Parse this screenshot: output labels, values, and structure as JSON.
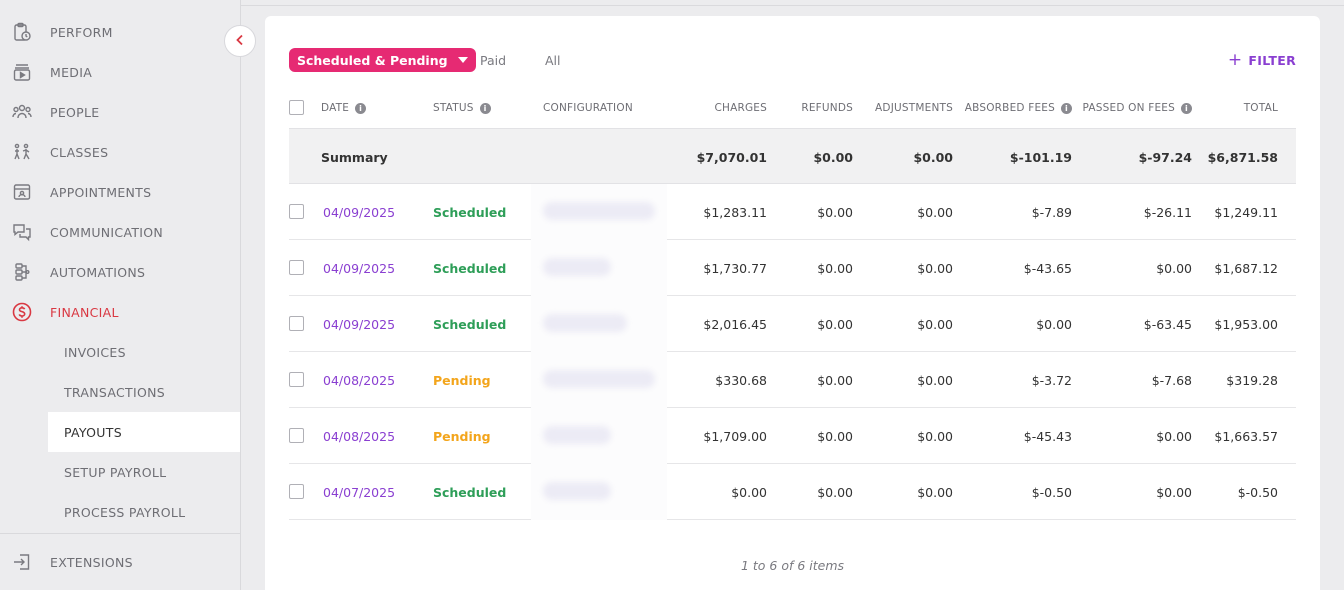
{
  "sidebar": {
    "items": [
      {
        "id": "perform",
        "label": "PERFORM",
        "icon": "clipboard-clock-icon"
      },
      {
        "id": "media",
        "label": "MEDIA",
        "icon": "media-play-icon"
      },
      {
        "id": "people",
        "label": "PEOPLE",
        "icon": "people-icon"
      },
      {
        "id": "classes",
        "label": "CLASSES",
        "icon": "classes-icon"
      },
      {
        "id": "appointments",
        "label": "APPOINTMENTS",
        "icon": "appointment-card-icon"
      },
      {
        "id": "communication",
        "label": "COMMUNICATION",
        "icon": "chat-bubbles-icon"
      },
      {
        "id": "automations",
        "label": "AUTOMATIONS",
        "icon": "automation-icon"
      },
      {
        "id": "financial",
        "label": "FINANCIAL",
        "icon": "dollar-circle-icon"
      }
    ],
    "financial_sub": [
      {
        "id": "invoices",
        "label": "INVOICES"
      },
      {
        "id": "transactions",
        "label": "TRANSACTIONS"
      },
      {
        "id": "payouts",
        "label": "PAYOUTS"
      },
      {
        "id": "setup-payroll",
        "label": "SETUP PAYROLL"
      },
      {
        "id": "process-payroll",
        "label": "PROCESS PAYROLL"
      }
    ],
    "extensions": {
      "label": "EXTENSIONS",
      "icon": "sign-in-icon"
    },
    "active": "financial",
    "selected_sub": "payouts"
  },
  "tabs": {
    "active": "Scheduled & Pending",
    "paid": "Paid",
    "all": "All"
  },
  "filter_label": "FILTER",
  "table": {
    "headers": {
      "date": "DATE",
      "status": "STATUS",
      "configuration": "CONFIGURATION",
      "charges": "CHARGES",
      "refunds": "REFUNDS",
      "adjustments": "ADJUSTMENTS",
      "absorbed_fees": "ABSORBED FEES",
      "passed_on_fees": "PASSED ON FEES",
      "total": "TOTAL"
    },
    "summary": {
      "label": "Summary",
      "charges": "$7,070.01",
      "refunds": "$0.00",
      "adjustments": "$0.00",
      "absorbed_fees": "$-101.19",
      "passed_on_fees": "$-97.24",
      "total": "$6,871.58"
    },
    "rows": [
      {
        "date": "04/09/2025",
        "status": "Scheduled",
        "charges": "$1,283.11",
        "refunds": "$0.00",
        "adjustments": "$0.00",
        "absorbed_fees": "$-7.89",
        "passed_on_fees": "$-26.11",
        "total": "$1,249.11"
      },
      {
        "date": "04/09/2025",
        "status": "Scheduled",
        "charges": "$1,730.77",
        "refunds": "$0.00",
        "adjustments": "$0.00",
        "absorbed_fees": "$-43.65",
        "passed_on_fees": "$0.00",
        "total": "$1,687.12"
      },
      {
        "date": "04/09/2025",
        "status": "Scheduled",
        "charges": "$2,016.45",
        "refunds": "$0.00",
        "adjustments": "$0.00",
        "absorbed_fees": "$0.00",
        "passed_on_fees": "$-63.45",
        "total": "$1,953.00"
      },
      {
        "date": "04/08/2025",
        "status": "Pending",
        "charges": "$330.68",
        "refunds": "$0.00",
        "adjustments": "$0.00",
        "absorbed_fees": "$-3.72",
        "passed_on_fees": "$-7.68",
        "total": "$319.28"
      },
      {
        "date": "04/08/2025",
        "status": "Pending",
        "charges": "$1,709.00",
        "refunds": "$0.00",
        "adjustments": "$0.00",
        "absorbed_fees": "$-45.43",
        "passed_on_fees": "$0.00",
        "total": "$1,663.57"
      },
      {
        "date": "04/07/2025",
        "status": "Scheduled",
        "charges": "$0.00",
        "refunds": "$0.00",
        "adjustments": "$0.00",
        "absorbed_fees": "$-0.50",
        "passed_on_fees": "$0.00",
        "total": "$-0.50"
      }
    ]
  },
  "pagination": "1 to 6 of 6 items",
  "colors": {
    "accent_pink": "#e62a73",
    "accent_purple": "#8a3fd1",
    "active_red": "#d93842",
    "scheduled_green": "#2e9e58",
    "pending_orange": "#f3a51c"
  }
}
